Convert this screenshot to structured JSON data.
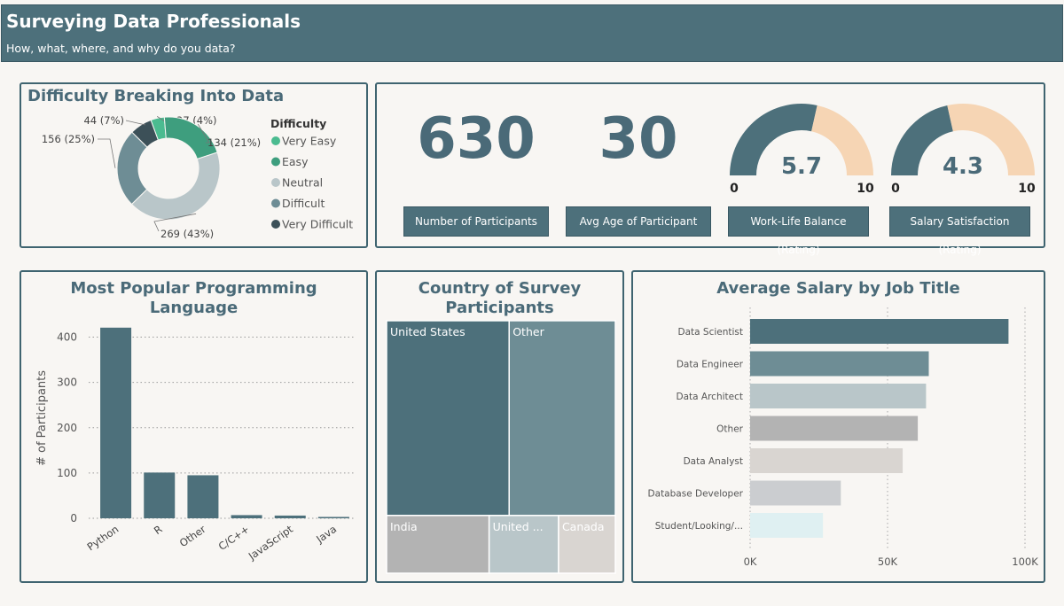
{
  "header": {
    "title": "Surveying Data Professionals",
    "subtitle": "How, what, where, and why do you data?"
  },
  "difficulty": {
    "title": "Difficulty Breaking Into Data",
    "legend_title": "Difficulty",
    "slice_labels": [
      "27 (4%)",
      "134 (21%)",
      "269 (43%)",
      "156 (25%)",
      "44 (7%)"
    ]
  },
  "kpis": {
    "participants": {
      "value": "630",
      "label": "Number of Participants"
    },
    "avg_age": {
      "value": "30",
      "label": "Avg Age of Participant"
    },
    "work_life": {
      "value": "5.7",
      "label": "Work-Life Balance (Rating)",
      "min": "0",
      "max": "10"
    },
    "salary_sat": {
      "value": "4.3",
      "label": "Salary Satisfaction (Rating)",
      "min": "0",
      "max": "10"
    }
  },
  "languages": {
    "title_line1": "Most Popular Programming",
    "title_line2": "Language"
  },
  "countries": {
    "title_line1": "Country of Survey",
    "title_line2": "Participants"
  },
  "salary": {
    "title": "Average Salary by Job Title"
  },
  "colors": {
    "dark_teal": "#4d707b",
    "mid_teal": "#6e8d95",
    "light_grey_blue": "#b9c6c9",
    "grey": "#b3b3b3",
    "light_warm_grey": "#d9d5d1",
    "light_grey": "#cbcdd0",
    "pale_cyan": "#dff0f2",
    "very_easy": "#4bbb90",
    "easy": "#3e9e7e",
    "neutral": "#b9c6c9",
    "difficult": "#6e8d95",
    "very_difficult": "#3c5058",
    "gauge_empty": "#f6d5b4"
  },
  "chart_data": [
    {
      "type": "pie",
      "title": "Difficulty Breaking Into Data",
      "legend_title": "Difficulty",
      "legend_position": "right",
      "categories": [
        "Very Easy",
        "Easy",
        "Neutral",
        "Difficult",
        "Very Difficult"
      ],
      "values": [
        27,
        134,
        269,
        156,
        44
      ],
      "percents": [
        4,
        21,
        43,
        25,
        7
      ],
      "colors": [
        "#4bbb90",
        "#3e9e7e",
        "#b9c6c9",
        "#6e8d95",
        "#3c5058"
      ]
    },
    {
      "type": "bar",
      "title": "Most Popular Programming Language",
      "ylabel": "# of Participants",
      "categories": [
        "Python",
        "R",
        "Other",
        "C/C++",
        "JavaScript",
        "Java"
      ],
      "values": [
        421,
        101,
        95,
        7,
        6,
        3
      ],
      "ylim": [
        0,
        450
      ],
      "yticks": [
        0,
        100,
        200,
        300,
        400
      ],
      "grid": true
    },
    {
      "type": "treemap",
      "title": "Country of Survey Participants",
      "categories": [
        "United States",
        "Other",
        "India",
        "United ...",
        "Canada"
      ],
      "values": [
        262,
        227,
        65,
        44,
        36
      ]
    },
    {
      "type": "bar",
      "orientation": "horizontal",
      "title": "Average Salary by Job Title",
      "categories": [
        "Data Scientist",
        "Data Engineer",
        "Data Architect",
        "Other",
        "Data Analyst",
        "Database Developer",
        "Student/Looking/..."
      ],
      "values": [
        94000,
        65000,
        64000,
        61000,
        55500,
        33000,
        26500
      ],
      "xlim": [
        0,
        100000
      ],
      "xticks": [
        "0K",
        "50K",
        "100K"
      ],
      "grid": true
    }
  ]
}
